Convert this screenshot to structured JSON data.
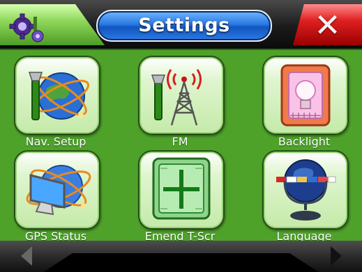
{
  "header": {
    "title": "Settings",
    "left_icon": "settings-gears-icon",
    "close_icon": "close-icon",
    "close_glyph": "✕"
  },
  "tiles": [
    {
      "label": "Nav. Setup",
      "icon": "navigation-setup-icon"
    },
    {
      "label": "FM",
      "icon": "fm-transmitter-icon"
    },
    {
      "label": "Backlight",
      "icon": "backlight-bulb-icon"
    },
    {
      "label": "GPS Status",
      "icon": "gps-status-icon"
    },
    {
      "label": "Emend T-Scr",
      "icon": "touchscreen-calibrate-icon"
    },
    {
      "label": "Language",
      "icon": "language-globe-icon"
    }
  ],
  "footer": {
    "prev_icon": "arrow-left-icon",
    "next_icon": "arrow-right-icon"
  },
  "colors": {
    "grid_background": "#4ea22a",
    "title_pill": "#2b79e3",
    "close_button": "#df2020",
    "header_accent": "#8fd85a"
  }
}
